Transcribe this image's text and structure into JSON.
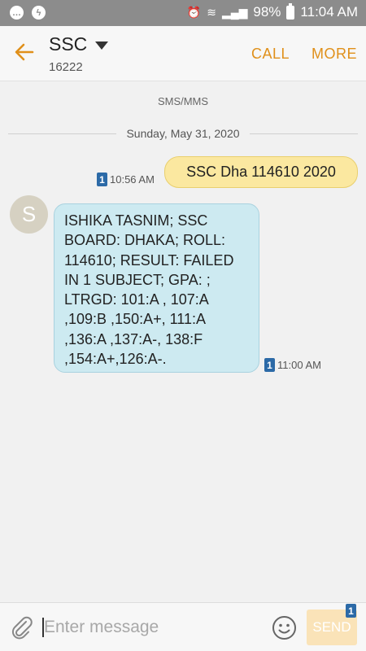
{
  "status_bar": {
    "battery": "98%",
    "time": "11:04 AM"
  },
  "header": {
    "title": "SSC",
    "subtitle": "16222",
    "call_label": "CALL",
    "more_label": "MORE"
  },
  "conversation": {
    "type_label": "SMS/MMS",
    "date": "Sunday, May 31, 2020",
    "messages": [
      {
        "direction": "outgoing",
        "text": "SSC Dha 114610 2020",
        "time": "10:56 AM",
        "sim": "1"
      },
      {
        "direction": "incoming",
        "avatar_letter": "S",
        "text": "ISHIKA TASNIM; SSC BOARD: DHAKA; ROLL: 114610; RESULT: FAILED IN 1 SUBJECT; GPA: ; LTRGD: 101:A , 107:A ,109:B ,150:A+, 111:A ,136:A ,137:A-, 138:F ,154:A+,126:A-.",
        "time": "11:00 AM",
        "sim": "1"
      }
    ]
  },
  "composer": {
    "placeholder": "Enter message",
    "send_label": "SEND",
    "sim": "1"
  },
  "colors": {
    "accent": "#e0901a",
    "outgoing_bubble": "#fbe8a0",
    "incoming_bubble": "#cdeaf1",
    "sim_badge": "#2c6aa7"
  }
}
